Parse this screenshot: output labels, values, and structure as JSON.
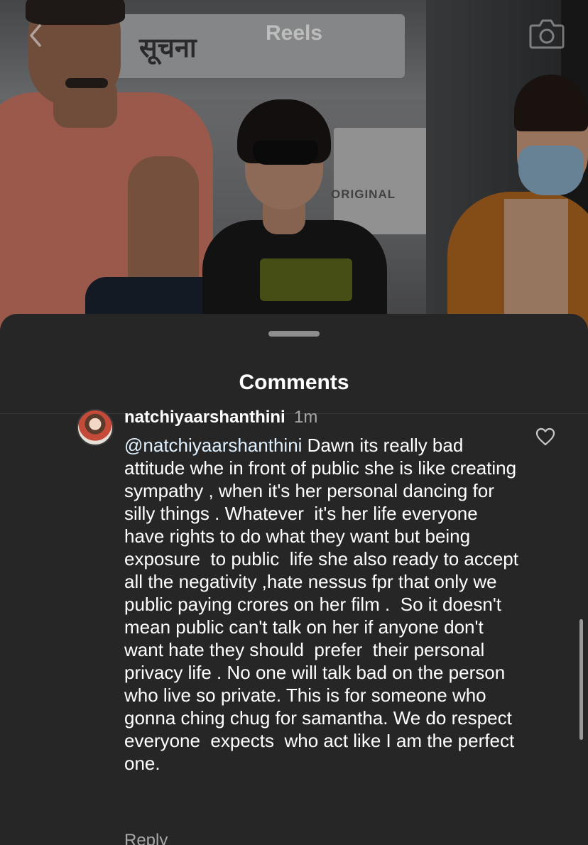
{
  "header": {
    "title": "Reels",
    "back_icon": "chevron-left-icon",
    "camera_icon": "camera-icon"
  },
  "video": {
    "sign_text": "सूचना",
    "counter_text": "ORIGINAL"
  },
  "comments_sheet": {
    "title": "Comments",
    "comments": [
      {
        "username": "natchiyaarshanthini",
        "time": "1m",
        "mention": "@natchiyaarshanthini",
        "text": " Dawn its really bad attitude whe in front of public she is like creating  sympathy , when it's her personal dancing for silly things . Whatever  it's her life everyone  have rights to do what they want but being exposure  to public  life she also ready to accept  all the negativity ,hate nessus fpr that only we public paying crores on her film .  So it doesn't  mean public can't talk on her if anyone don't want hate they should  prefer  their personal  privacy life . No one will talk bad on the person who live so private. This is for someone who gonna ching chug for samantha. We do respect everyone  expects  who act like I am the perfect one.",
        "reply_label": "Reply",
        "like_icon": "heart-icon"
      }
    ]
  },
  "colors": {
    "sheet_background": "#262626",
    "text_primary": "#ffffff",
    "text_secondary": "#a8a8a8"
  }
}
